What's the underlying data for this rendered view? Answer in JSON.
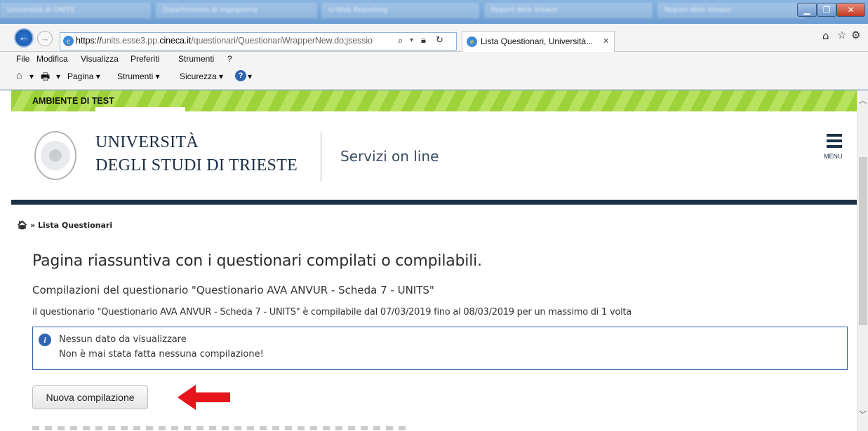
{
  "browser": {
    "title_tabs": [
      "Università di UNITS",
      "Dipartimento di Ingegneria",
      "U-Web Reporting",
      "Report Web Viewer",
      "Report Web Viewer"
    ],
    "url_scheme": "https://",
    "url_mid": "units.esse3.pp.",
    "url_domain": "cineca.it",
    "url_path": "/questionari/QuestionariWrapperNew.do;jsessio",
    "active_tab_title": "Lista Questionari, Università...",
    "menu": [
      "File",
      "Modifica",
      "Visualizza",
      "Preferiti",
      "Strumenti",
      "?"
    ],
    "commands": [
      "Pagina ▾",
      "Strumenti ▾",
      "Sicurezza ▾"
    ]
  },
  "page": {
    "test_banner": "AMBIENTE DI TEST",
    "university_line1": "UNIVERSITÀ",
    "university_line2": "DEGLI STUDI DI TRIESTE",
    "services": "Servizi on line",
    "menu_label": "MENU",
    "breadcrumb_sep": "»",
    "breadcrumb_current": "Lista Questionari",
    "heading": "Pagina riassuntiva con i questionari compilati o compilabili.",
    "subheading": "Compilazioni del questionario \"Questionario AVA ANVUR - Scheda 7 - UNITS\"",
    "info_text": "il questionario \"Questionario AVA ANVUR - Scheda 7 - UNITS\"  è compilabile dal 07/03/2019 fino al 08/03/2019 per un massimo di 1 volta",
    "no_data": "Nessun dato da visualizzare",
    "no_compilation": "Non è mai stata fatta nessuna compilazione!",
    "new_button": "Nuova compilazione"
  },
  "colors": {
    "accent_navy": "#1c3146",
    "test_green": "#9dd23a",
    "info_blue": "#2f63b5",
    "arrow_red": "#e8141b"
  }
}
